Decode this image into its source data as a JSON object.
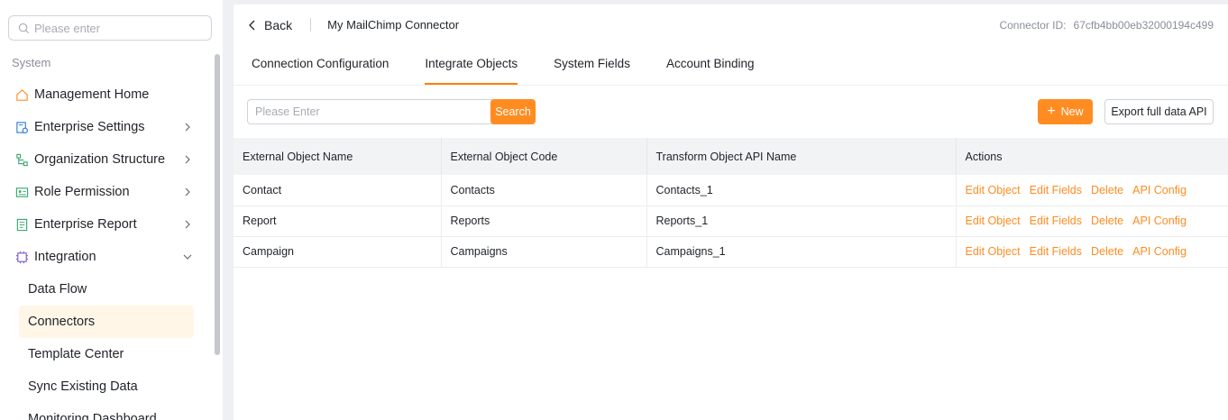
{
  "sidebar": {
    "search_placeholder": "Please enter",
    "section": "System",
    "items": [
      {
        "label": "Management Home",
        "icon": "home-icon"
      },
      {
        "label": "Enterprise Settings",
        "icon": "settings-icon"
      },
      {
        "label": "Organization Structure",
        "icon": "org-icon"
      },
      {
        "label": "Role Permission",
        "icon": "id-card-icon"
      },
      {
        "label": "Enterprise Report",
        "icon": "report-icon"
      },
      {
        "label": "Integration",
        "icon": "chip-icon"
      }
    ],
    "sub_items": [
      "Data Flow",
      "Connectors",
      "Template Center",
      "Sync Existing Data",
      "Monitoring Dashboard"
    ]
  },
  "header": {
    "back": "Back",
    "connector_name": "My MailChimp Connector",
    "connector_id_label": "Connector ID:",
    "connector_id": "67cfb4bb00eb32000194c499"
  },
  "tabs": [
    "Connection Configuration",
    "Integrate Objects",
    "System Fields",
    "Account Binding"
  ],
  "active_tab": "Integrate Objects",
  "toolbar": {
    "search_placeholder": "Please Enter",
    "search_button": "Search",
    "new_button": "New",
    "export_button": "Export full data API"
  },
  "table": {
    "columns": [
      "External Object Name",
      "External Object Code",
      "Transform Object API Name",
      "Actions"
    ],
    "rows": [
      [
        "Contact",
        "Contacts",
        "Contacts_1"
      ],
      [
        "Report",
        "Reports",
        "Reports_1"
      ],
      [
        "Campaign",
        "Campaigns",
        "Campaigns_1"
      ]
    ],
    "actions": [
      "Edit Object",
      "Edit Fields",
      "Delete",
      "API Config"
    ]
  },
  "colors": {
    "accent": "#ff8c21"
  }
}
